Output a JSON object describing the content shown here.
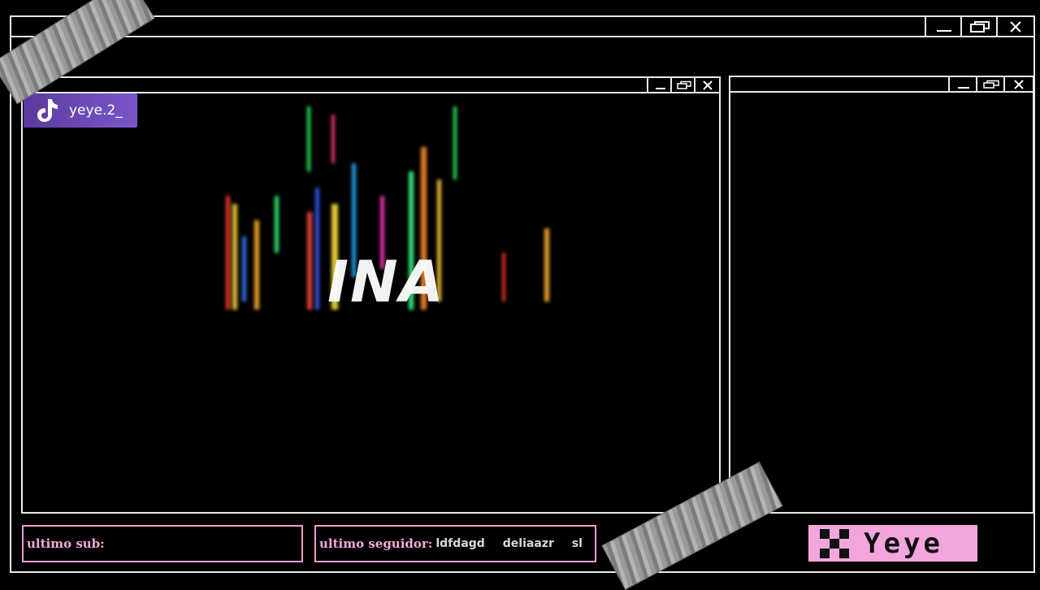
{
  "social": {
    "platform_icon": "tiktok-icon",
    "handle": "yeye.2_"
  },
  "glitch_text": "INA",
  "alerts": {
    "sub_label": "ultimo sub:",
    "follower_label": "ultimo seguidor:",
    "followers": [
      "ldfdagd",
      "deliaazr",
      "sl"
    ]
  },
  "namecard": {
    "icon": "checker-icon",
    "name": "Yeye"
  },
  "colors": {
    "frame": "#e9e9e9",
    "pink": "#f3a6dc",
    "social_purple": "#6a48b8"
  },
  "window_icons": [
    "minimize-icon",
    "restore-icon",
    "close-icon"
  ]
}
